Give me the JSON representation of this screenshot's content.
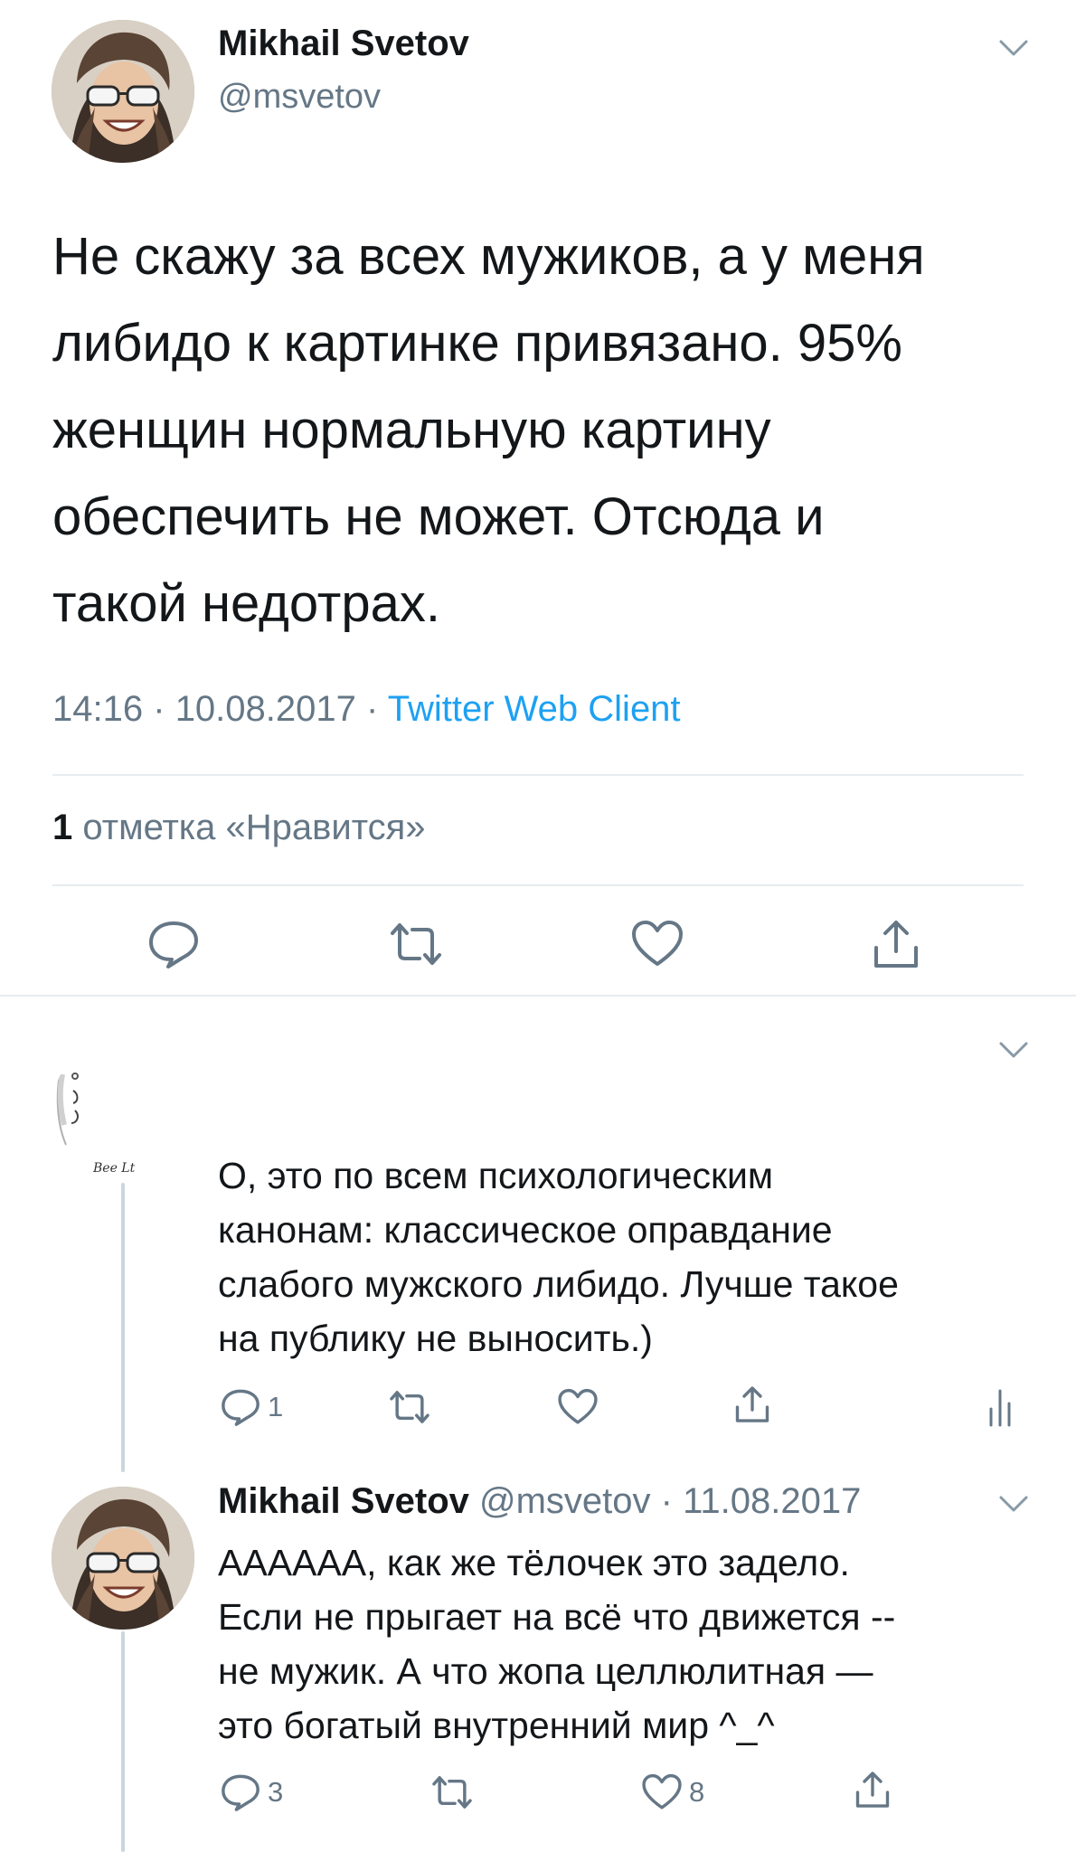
{
  "main_tweet": {
    "author_name": "Mikhail Svetov",
    "author_handle": "@msvetov",
    "text_lines": [
      "Не скажу за всех мужиков, а у меня",
      "либидо к картинке привязано. 95%",
      "женщин нормальную картину",
      "обеспечить не может. Отсюда и",
      "такой недотрах."
    ],
    "time": "14:16",
    "date": "10.08.2017",
    "separator": "·",
    "client": "Twitter Web Client",
    "likes_count": "1",
    "likes_label": "отметка «Нравится»",
    "icons": [
      "reply-icon",
      "retweet-icon",
      "like-icon",
      "share-icon",
      "chevron-down-icon"
    ]
  },
  "reply_1": {
    "avatar_scribble": "Bee Lt",
    "text_lines": [
      "О, это по всем психологическим",
      "канонам: классическое оправдание",
      "слабого мужского либидо. Лучше такое",
      "на публику не выносить.)"
    ],
    "reply_count": "1",
    "icons": [
      "reply-icon",
      "retweet-icon",
      "like-icon",
      "share-icon",
      "analytics-icon",
      "chevron-down-icon"
    ]
  },
  "reply_2": {
    "author_name": "Mikhail Svetov",
    "author_handle": "@msvetov",
    "separator": "·",
    "date": "11.08.2017",
    "text_lines": [
      "АААААА, как же  тёлочек это задело.",
      "Если не прыгает на всё что движется --",
      "не мужик. А что жопа целлюлитная —",
      "это богатый внутренний мир ^_^"
    ],
    "reply_count": "3",
    "like_count": "8",
    "icons": [
      "reply-icon",
      "retweet-icon",
      "like-icon",
      "share-icon",
      "chevron-down-icon"
    ]
  },
  "colors": {
    "text": "#14171a",
    "muted": "#657786",
    "link": "#1da1f2",
    "divider": "#e6ecf0",
    "thread_line": "#ccd6dd"
  }
}
